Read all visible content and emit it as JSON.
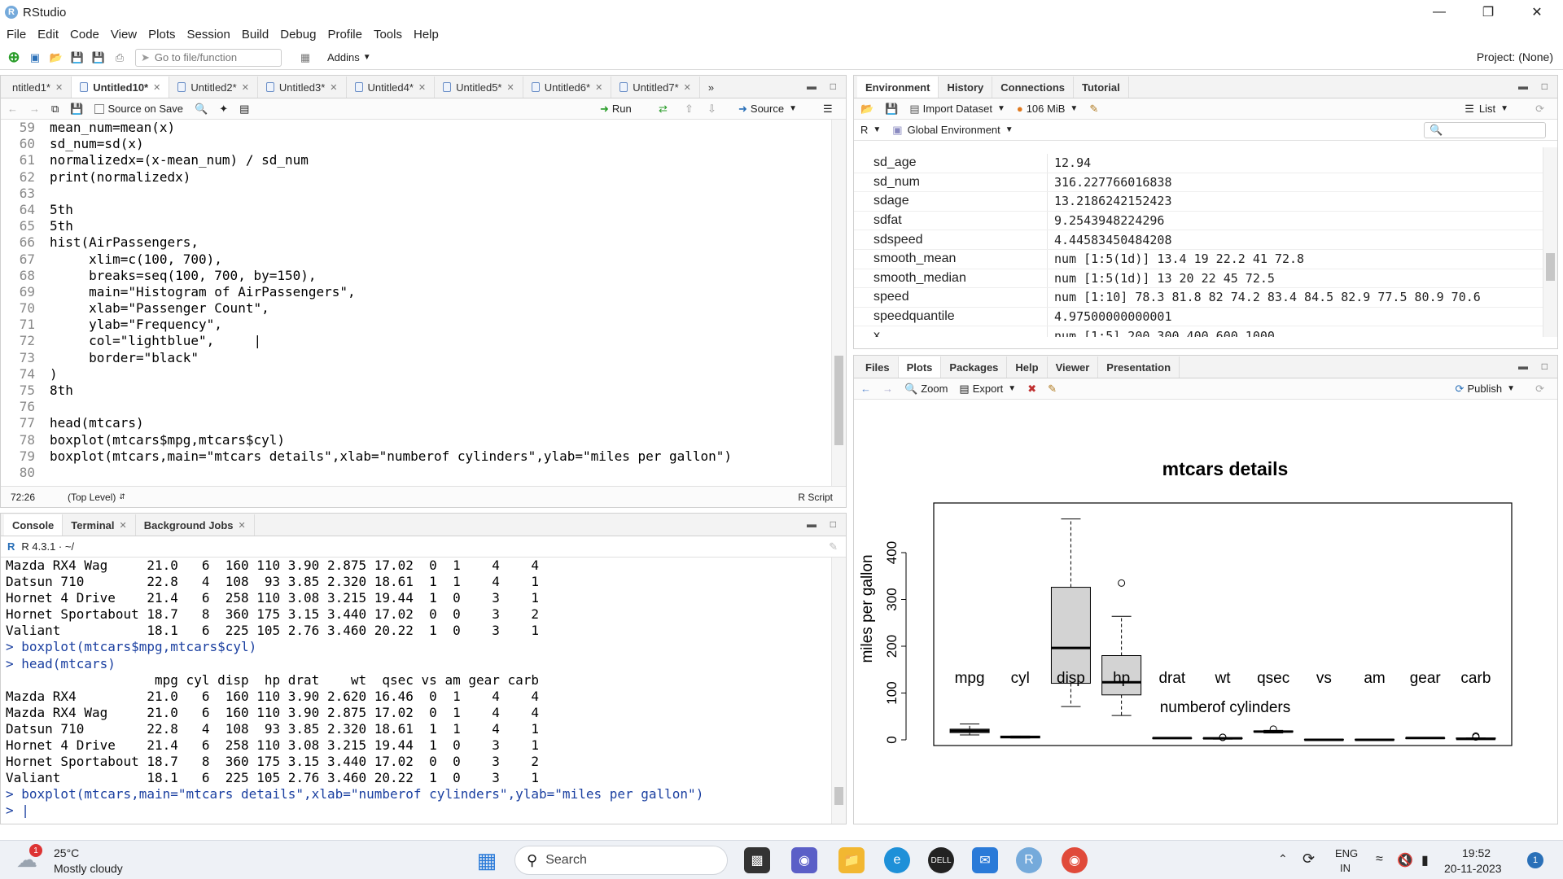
{
  "window": {
    "title": "RStudio"
  },
  "menu": [
    "File",
    "Edit",
    "Code",
    "View",
    "Plots",
    "Session",
    "Build",
    "Debug",
    "Profile",
    "Tools",
    "Help"
  ],
  "toolbar": {
    "goto_placeholder": "Go to file/function",
    "addins": "Addins",
    "project": "Project: (None)"
  },
  "editor": {
    "tabs": [
      "ntitled1*",
      "Untitled10*",
      "Untitled2*",
      "Untitled3*",
      "Untitled4*",
      "Untitled5*",
      "Untitled6*",
      "Untitled7*"
    ],
    "source_on_save": "Source on Save",
    "run": "Run",
    "source": "Source",
    "lines": [
      {
        "n": "59",
        "t": "mean_num=mean(x)"
      },
      {
        "n": "60",
        "t": "sd_num=sd(x)"
      },
      {
        "n": "61",
        "t": "normalizedx=(x-mean_num) / sd_num"
      },
      {
        "n": "62",
        "t": "print(normalizedx)"
      },
      {
        "n": "63",
        "t": ""
      },
      {
        "n": "64",
        "t": "5th"
      },
      {
        "n": "65",
        "t": "5th"
      },
      {
        "n": "66",
        "t": "hist(AirPassengers,"
      },
      {
        "n": "67",
        "t": "     xlim=c(100, 700),"
      },
      {
        "n": "68",
        "t": "     breaks=seq(100, 700, by=150),"
      },
      {
        "n": "69",
        "t": "     main=\"Histogram of AirPassengers\","
      },
      {
        "n": "70",
        "t": "     xlab=\"Passenger Count\","
      },
      {
        "n": "71",
        "t": "     ylab=\"Frequency\","
      },
      {
        "n": "72",
        "t": "     col=\"lightblue\",     |"
      },
      {
        "n": "73",
        "t": "     border=\"black\""
      },
      {
        "n": "74",
        "t": ")"
      },
      {
        "n": "75",
        "t": "8th"
      },
      {
        "n": "76",
        "t": ""
      },
      {
        "n": "77",
        "t": "head(mtcars)"
      },
      {
        "n": "78",
        "t": "boxplot(mtcars$mpg,mtcars$cyl)"
      },
      {
        "n": "79",
        "t": "boxplot(mtcars,main=\"mtcars details\",xlab=\"numberof cylinders\",ylab=\"miles per gallon\")"
      },
      {
        "n": "80",
        "t": ""
      }
    ],
    "status_pos": "72:26",
    "status_level": "(Top Level)",
    "status_type": "R Script"
  },
  "console": {
    "tabs": [
      "Console",
      "Terminal",
      "Background Jobs"
    ],
    "version": "R 4.3.1 · ~/",
    "lines": [
      {
        "t": "Mazda RX4 Wag     21.0   6  160 110 3.90 2.875 17.02  0  1    4    4",
        "c": false
      },
      {
        "t": "Datsun 710        22.8   4  108  93 3.85 2.320 18.61  1  1    4    1",
        "c": false
      },
      {
        "t": "Hornet 4 Drive    21.4   6  258 110 3.08 3.215 19.44  1  0    3    1",
        "c": false
      },
      {
        "t": "Hornet Sportabout 18.7   8  360 175 3.15 3.440 17.02  0  0    3    2",
        "c": false
      },
      {
        "t": "Valiant           18.1   6  225 105 2.76 3.460 20.22  1  0    3    1",
        "c": false
      },
      {
        "t": "> boxplot(mtcars$mpg,mtcars$cyl)",
        "c": true
      },
      {
        "t": "> head(mtcars)",
        "c": true
      },
      {
        "t": "                   mpg cyl disp  hp drat    wt  qsec vs am gear carb",
        "c": false
      },
      {
        "t": "Mazda RX4         21.0   6  160 110 3.90 2.620 16.46  0  1    4    4",
        "c": false
      },
      {
        "t": "Mazda RX4 Wag     21.0   6  160 110 3.90 2.875 17.02  0  1    4    4",
        "c": false
      },
      {
        "t": "Datsun 710        22.8   4  108  93 3.85 2.320 18.61  1  1    4    1",
        "c": false
      },
      {
        "t": "Hornet 4 Drive    21.4   6  258 110 3.08 3.215 19.44  1  0    3    1",
        "c": false
      },
      {
        "t": "Hornet Sportabout 18.7   8  360 175 3.15 3.440 17.02  0  0    3    2",
        "c": false
      },
      {
        "t": "Valiant           18.1   6  225 105 2.76 3.460 20.22  1  0    3    1",
        "c": false
      },
      {
        "t": "> boxplot(mtcars,main=\"mtcars details\",xlab=\"numberof cylinders\",ylab=\"miles per gallon\")",
        "c": true
      },
      {
        "t": "> |",
        "c": true
      }
    ]
  },
  "environment": {
    "tabs": [
      "Environment",
      "History",
      "Connections",
      "Tutorial"
    ],
    "import": "Import Dataset",
    "memory": "106 MiB",
    "view": "List",
    "scope": "Global Environment",
    "lang": "R",
    "rows": [
      {
        "name": "sd_age",
        "value": "12.94"
      },
      {
        "name": "sd_num",
        "value": "316.227766016838"
      },
      {
        "name": "sdage",
        "value": "13.2186242152423"
      },
      {
        "name": "sdfat",
        "value": "9.2543948224296"
      },
      {
        "name": "sdspeed",
        "value": "4.44583450484208"
      },
      {
        "name": "smooth_mean",
        "value": "num [1:5(1d)] 13.4 19 22.2 41 72.8"
      },
      {
        "name": "smooth_median",
        "value": "num [1:5(1d)] 13 20 22 45 72.5"
      },
      {
        "name": "speed",
        "value": "num [1:10] 78.3 81.8 82 74.2 83.4 84.5 82.9 77.5 80.9 70.6"
      },
      {
        "name": "speedquantile",
        "value": "4.97500000000001"
      },
      {
        "name": "x",
        "value": "num [1:5] 200 300 400 600 1000"
      }
    ]
  },
  "files": {
    "tabs": [
      "Files",
      "Plots",
      "Packages",
      "Help",
      "Viewer",
      "Presentation"
    ],
    "zoom": "Zoom",
    "export": "Export",
    "publish": "Publish"
  },
  "chart_data": {
    "type": "box",
    "title": "mtcars details",
    "xlabel": "numberof cylinders",
    "ylabel": "miles per gallon",
    "ylim": [
      0,
      480
    ],
    "yticks": [
      0,
      100,
      200,
      300,
      400
    ],
    "categories": [
      "mpg",
      "cyl",
      "disp",
      "hp",
      "drat",
      "wt",
      "qsec",
      "vs",
      "am",
      "gear",
      "carb"
    ],
    "boxes": [
      {
        "min": 10.4,
        "q1": 15.4,
        "median": 19.2,
        "q3": 22.8,
        "max": 33.9,
        "outliers": []
      },
      {
        "min": 4,
        "q1": 4,
        "median": 6,
        "q3": 8,
        "max": 8,
        "outliers": []
      },
      {
        "min": 71.1,
        "q1": 120.8,
        "median": 196.3,
        "q3": 326,
        "max": 472,
        "outliers": []
      },
      {
        "min": 52,
        "q1": 96,
        "median": 123,
        "q3": 180,
        "max": 264,
        "outliers": [
          335
        ]
      },
      {
        "min": 2.76,
        "q1": 3.08,
        "median": 3.7,
        "q3": 3.92,
        "max": 4.93,
        "outliers": []
      },
      {
        "min": 1.5,
        "q1": 2.6,
        "median": 3.3,
        "q3": 3.6,
        "max": 4.1,
        "outliers": [
          5.3,
          5.4
        ]
      },
      {
        "min": 14.5,
        "q1": 16.9,
        "median": 17.7,
        "q3": 18.9,
        "max": 20.2,
        "outliers": [
          22.9
        ]
      },
      {
        "min": 0,
        "q1": 0,
        "median": 0,
        "q3": 1,
        "max": 1,
        "outliers": []
      },
      {
        "min": 0,
        "q1": 0,
        "median": 0,
        "q3": 1,
        "max": 1,
        "outliers": []
      },
      {
        "min": 3,
        "q1": 3,
        "median": 4,
        "q3": 4,
        "max": 5,
        "outliers": []
      },
      {
        "min": 1,
        "q1": 2,
        "median": 2,
        "q3": 4,
        "max": 4,
        "outliers": [
          6,
          8
        ]
      }
    ]
  },
  "taskbar": {
    "temp": "25°C",
    "weather": "Mostly cloudy",
    "search": "Search",
    "lang1": "ENG",
    "lang2": "IN",
    "time": "19:52",
    "date": "20-11-2023",
    "notif": "1"
  }
}
